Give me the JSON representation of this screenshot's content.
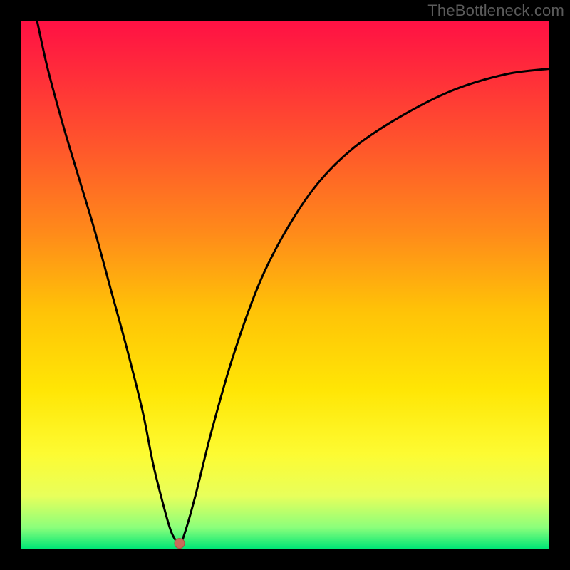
{
  "watermark": "TheBottleneck.com",
  "colors": {
    "black": "#000000",
    "gradient_stops": [
      {
        "offset": 0.0,
        "color": "#ff1144"
      },
      {
        "offset": 0.1,
        "color": "#ff2d3a"
      },
      {
        "offset": 0.25,
        "color": "#ff5a2a"
      },
      {
        "offset": 0.4,
        "color": "#ff8a1a"
      },
      {
        "offset": 0.55,
        "color": "#ffc307"
      },
      {
        "offset": 0.7,
        "color": "#ffe605"
      },
      {
        "offset": 0.82,
        "color": "#fdfb32"
      },
      {
        "offset": 0.9,
        "color": "#e8ff5b"
      },
      {
        "offset": 0.96,
        "color": "#8bff7b"
      },
      {
        "offset": 1.0,
        "color": "#00e676"
      }
    ],
    "curve": "#000000",
    "marker_fill": "#c96a5a",
    "marker_stroke": "#a84f42"
  },
  "chart_data": {
    "type": "line",
    "title": "",
    "xlabel": "",
    "ylabel": "",
    "xlim": [
      0,
      100
    ],
    "ylim": [
      0,
      100
    ],
    "grid": false,
    "legend": false,
    "series": [
      {
        "name": "bottleneck-curve",
        "x": [
          3,
          5,
          8,
          11,
          14,
          17,
          20,
          23,
          25,
          27,
          28.5,
          30,
          31,
          33,
          36,
          40,
          45,
          50,
          56,
          63,
          72,
          82,
          92,
          100
        ],
        "y": [
          100,
          91,
          80,
          70,
          60,
          49,
          38,
          26,
          16,
          8,
          3,
          1,
          3,
          10,
          22,
          36,
          50,
          60,
          69,
          76,
          82,
          87,
          90,
          91
        ]
      }
    ],
    "marker": {
      "x": 30,
      "y": 1
    },
    "notes": "V-shaped bottleneck curve over red-to-green vertical gradient; minimum near x≈30 at y≈1; values estimated from pixels."
  }
}
